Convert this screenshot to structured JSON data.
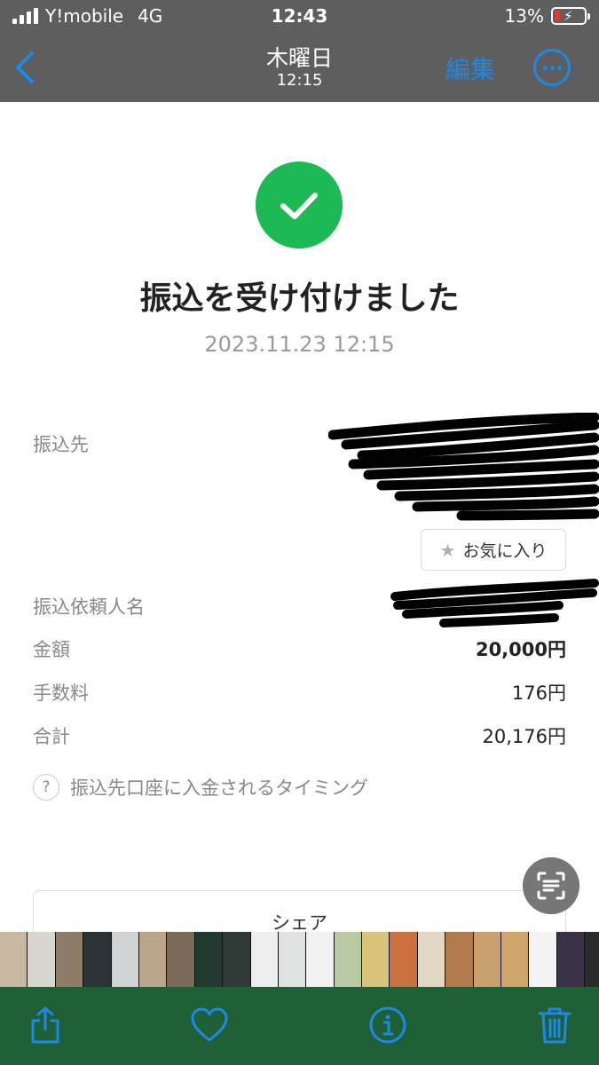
{
  "status": {
    "carrier": "Y!mobile",
    "network": "4G",
    "time": "12:43",
    "battery": "13%"
  },
  "nav": {
    "title": "木曜日",
    "subtitle": "12:15",
    "edit_label": "編集"
  },
  "result": {
    "headline": "振込を受け付けました",
    "datetime": "2023.11.23 12:15"
  },
  "details": {
    "recipient_label": "振込先",
    "favorite_label": "お気に入り",
    "requester_label": "振込依頼人名",
    "amount_label": "金額",
    "amount_value": "20,000円",
    "fee_label": "手数料",
    "fee_value": "176円",
    "total_label": "合計",
    "total_value": "20,176円"
  },
  "help": {
    "timing_label": "振込先口座に入金されるタイミング"
  },
  "share": {
    "label": "シェア"
  },
  "colors": {
    "status_bg": "#5e5e5e",
    "accent_blue": "#1e88e5",
    "success_green": "#1db954",
    "toolbar_bg": "#1e5f36",
    "toolbar_icon": "#1e88e5"
  },
  "thumbnails": [
    "#c9b9a0",
    "#d8d6cf",
    "#8d7b66",
    "#2a3236",
    "#cfd3d4",
    "#bba58a",
    "#7a6a58",
    "#223a30",
    "#2f3a36",
    "#ededed",
    "#dfe3df",
    "#f1f1f1",
    "#b8c9a4",
    "#d9c27a",
    "#c9713f",
    "#e2d7c2",
    "#b07a4d",
    "#caa06f",
    "#d0a56b",
    "#f3f3f3",
    "#3a3148",
    "#2a2a2a"
  ],
  "icons": [
    "signal-icon",
    "battery-icon",
    "back-chevron-icon",
    "more-icon",
    "checkmark-icon",
    "star-icon",
    "question-icon",
    "text-scan-icon",
    "share-icon",
    "heart-icon",
    "info-icon",
    "trash-icon"
  ]
}
